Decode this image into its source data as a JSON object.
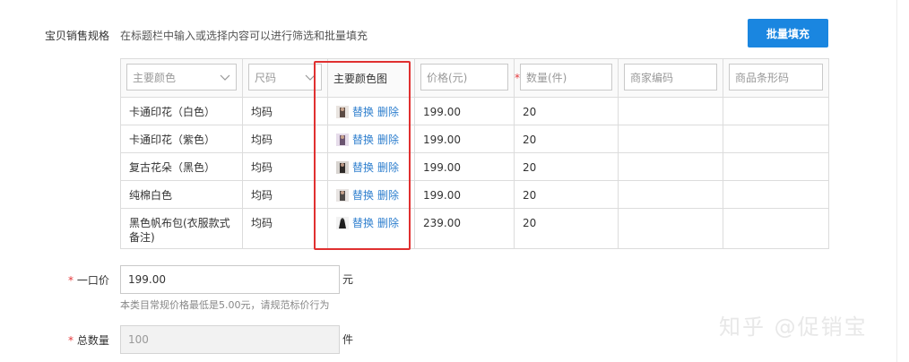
{
  "sales_spec": {
    "label": "宝贝销售规格",
    "hint": "在标题栏中输入或选择内容可以进行筛选和批量填充",
    "bulk_fill_button": "批量填充"
  },
  "table": {
    "headers": {
      "main_color": "主要颜色",
      "size": "尺码",
      "main_color_image": "主要颜色图",
      "price": "价格(元)",
      "quantity_required_mark": "*",
      "quantity": "数量(件)",
      "merchant_code": "商家编码",
      "barcode": "商品条形码"
    },
    "rows": [
      {
        "color": "卡通印花（白色）",
        "size": "均码",
        "replace": "替换",
        "delete": "删除",
        "price": "199.00",
        "qty": "20"
      },
      {
        "color": "卡通印花（紫色）",
        "size": "均码",
        "replace": "替换",
        "delete": "删除",
        "price": "199.00",
        "qty": "20"
      },
      {
        "color": "复古花朵（黑色）",
        "size": "均码",
        "replace": "替换",
        "delete": "删除",
        "price": "199.00",
        "qty": "20"
      },
      {
        "color": "纯棉白色",
        "size": "均码",
        "replace": "替换",
        "delete": "删除",
        "price": "199.00",
        "qty": "20"
      },
      {
        "color": "黑色帆布包(衣服款式备注)",
        "size": "均码",
        "replace": "替换",
        "delete": "删除",
        "price": "239.00",
        "qty": "20"
      }
    ]
  },
  "price_field": {
    "required_mark": "*",
    "label": "一口价",
    "value": "199.00",
    "unit": "元",
    "note": "本类目常规价格最低是5.00元，请规范标价行为"
  },
  "total_field": {
    "required_mark": "*",
    "label": "总数量",
    "value": "100",
    "unit": "件"
  },
  "watermark": "知乎 @促销宝",
  "colors": {
    "accent": "#1a86e0",
    "link": "#2f7fce",
    "highlight_box": "#e03030",
    "required": "#e4393c"
  }
}
